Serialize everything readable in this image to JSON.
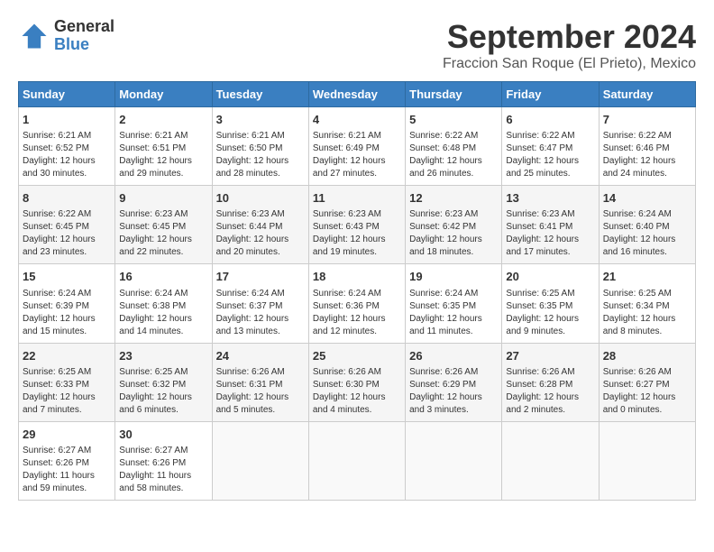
{
  "header": {
    "logo_general": "General",
    "logo_blue": "Blue",
    "month_title": "September 2024",
    "location": "Fraccion San Roque (El Prieto), Mexico"
  },
  "days_of_week": [
    "Sunday",
    "Monday",
    "Tuesday",
    "Wednesday",
    "Thursday",
    "Friday",
    "Saturday"
  ],
  "weeks": [
    [
      {
        "day": "1",
        "sunrise": "Sunrise: 6:21 AM",
        "sunset": "Sunset: 6:52 PM",
        "daylight": "Daylight: 12 hours and 30 minutes."
      },
      {
        "day": "2",
        "sunrise": "Sunrise: 6:21 AM",
        "sunset": "Sunset: 6:51 PM",
        "daylight": "Daylight: 12 hours and 29 minutes."
      },
      {
        "day": "3",
        "sunrise": "Sunrise: 6:21 AM",
        "sunset": "Sunset: 6:50 PM",
        "daylight": "Daylight: 12 hours and 28 minutes."
      },
      {
        "day": "4",
        "sunrise": "Sunrise: 6:21 AM",
        "sunset": "Sunset: 6:49 PM",
        "daylight": "Daylight: 12 hours and 27 minutes."
      },
      {
        "day": "5",
        "sunrise": "Sunrise: 6:22 AM",
        "sunset": "Sunset: 6:48 PM",
        "daylight": "Daylight: 12 hours and 26 minutes."
      },
      {
        "day": "6",
        "sunrise": "Sunrise: 6:22 AM",
        "sunset": "Sunset: 6:47 PM",
        "daylight": "Daylight: 12 hours and 25 minutes."
      },
      {
        "day": "7",
        "sunrise": "Sunrise: 6:22 AM",
        "sunset": "Sunset: 6:46 PM",
        "daylight": "Daylight: 12 hours and 24 minutes."
      }
    ],
    [
      {
        "day": "8",
        "sunrise": "Sunrise: 6:22 AM",
        "sunset": "Sunset: 6:45 PM",
        "daylight": "Daylight: 12 hours and 23 minutes."
      },
      {
        "day": "9",
        "sunrise": "Sunrise: 6:23 AM",
        "sunset": "Sunset: 6:45 PM",
        "daylight": "Daylight: 12 hours and 22 minutes."
      },
      {
        "day": "10",
        "sunrise": "Sunrise: 6:23 AM",
        "sunset": "Sunset: 6:44 PM",
        "daylight": "Daylight: 12 hours and 20 minutes."
      },
      {
        "day": "11",
        "sunrise": "Sunrise: 6:23 AM",
        "sunset": "Sunset: 6:43 PM",
        "daylight": "Daylight: 12 hours and 19 minutes."
      },
      {
        "day": "12",
        "sunrise": "Sunrise: 6:23 AM",
        "sunset": "Sunset: 6:42 PM",
        "daylight": "Daylight: 12 hours and 18 minutes."
      },
      {
        "day": "13",
        "sunrise": "Sunrise: 6:23 AM",
        "sunset": "Sunset: 6:41 PM",
        "daylight": "Daylight: 12 hours and 17 minutes."
      },
      {
        "day": "14",
        "sunrise": "Sunrise: 6:24 AM",
        "sunset": "Sunset: 6:40 PM",
        "daylight": "Daylight: 12 hours and 16 minutes."
      }
    ],
    [
      {
        "day": "15",
        "sunrise": "Sunrise: 6:24 AM",
        "sunset": "Sunset: 6:39 PM",
        "daylight": "Daylight: 12 hours and 15 minutes."
      },
      {
        "day": "16",
        "sunrise": "Sunrise: 6:24 AM",
        "sunset": "Sunset: 6:38 PM",
        "daylight": "Daylight: 12 hours and 14 minutes."
      },
      {
        "day": "17",
        "sunrise": "Sunrise: 6:24 AM",
        "sunset": "Sunset: 6:37 PM",
        "daylight": "Daylight: 12 hours and 13 minutes."
      },
      {
        "day": "18",
        "sunrise": "Sunrise: 6:24 AM",
        "sunset": "Sunset: 6:36 PM",
        "daylight": "Daylight: 12 hours and 12 minutes."
      },
      {
        "day": "19",
        "sunrise": "Sunrise: 6:24 AM",
        "sunset": "Sunset: 6:35 PM",
        "daylight": "Daylight: 12 hours and 11 minutes."
      },
      {
        "day": "20",
        "sunrise": "Sunrise: 6:25 AM",
        "sunset": "Sunset: 6:35 PM",
        "daylight": "Daylight: 12 hours and 9 minutes."
      },
      {
        "day": "21",
        "sunrise": "Sunrise: 6:25 AM",
        "sunset": "Sunset: 6:34 PM",
        "daylight": "Daylight: 12 hours and 8 minutes."
      }
    ],
    [
      {
        "day": "22",
        "sunrise": "Sunrise: 6:25 AM",
        "sunset": "Sunset: 6:33 PM",
        "daylight": "Daylight: 12 hours and 7 minutes."
      },
      {
        "day": "23",
        "sunrise": "Sunrise: 6:25 AM",
        "sunset": "Sunset: 6:32 PM",
        "daylight": "Daylight: 12 hours and 6 minutes."
      },
      {
        "day": "24",
        "sunrise": "Sunrise: 6:26 AM",
        "sunset": "Sunset: 6:31 PM",
        "daylight": "Daylight: 12 hours and 5 minutes."
      },
      {
        "day": "25",
        "sunrise": "Sunrise: 6:26 AM",
        "sunset": "Sunset: 6:30 PM",
        "daylight": "Daylight: 12 hours and 4 minutes."
      },
      {
        "day": "26",
        "sunrise": "Sunrise: 6:26 AM",
        "sunset": "Sunset: 6:29 PM",
        "daylight": "Daylight: 12 hours and 3 minutes."
      },
      {
        "day": "27",
        "sunrise": "Sunrise: 6:26 AM",
        "sunset": "Sunset: 6:28 PM",
        "daylight": "Daylight: 12 hours and 2 minutes."
      },
      {
        "day": "28",
        "sunrise": "Sunrise: 6:26 AM",
        "sunset": "Sunset: 6:27 PM",
        "daylight": "Daylight: 12 hours and 0 minutes."
      }
    ],
    [
      {
        "day": "29",
        "sunrise": "Sunrise: 6:27 AM",
        "sunset": "Sunset: 6:26 PM",
        "daylight": "Daylight: 11 hours and 59 minutes."
      },
      {
        "day": "30",
        "sunrise": "Sunrise: 6:27 AM",
        "sunset": "Sunset: 6:26 PM",
        "daylight": "Daylight: 11 hours and 58 minutes."
      },
      {
        "day": "",
        "sunrise": "",
        "sunset": "",
        "daylight": ""
      },
      {
        "day": "",
        "sunrise": "",
        "sunset": "",
        "daylight": ""
      },
      {
        "day": "",
        "sunrise": "",
        "sunset": "",
        "daylight": ""
      },
      {
        "day": "",
        "sunrise": "",
        "sunset": "",
        "daylight": ""
      },
      {
        "day": "",
        "sunrise": "",
        "sunset": "",
        "daylight": ""
      }
    ]
  ]
}
